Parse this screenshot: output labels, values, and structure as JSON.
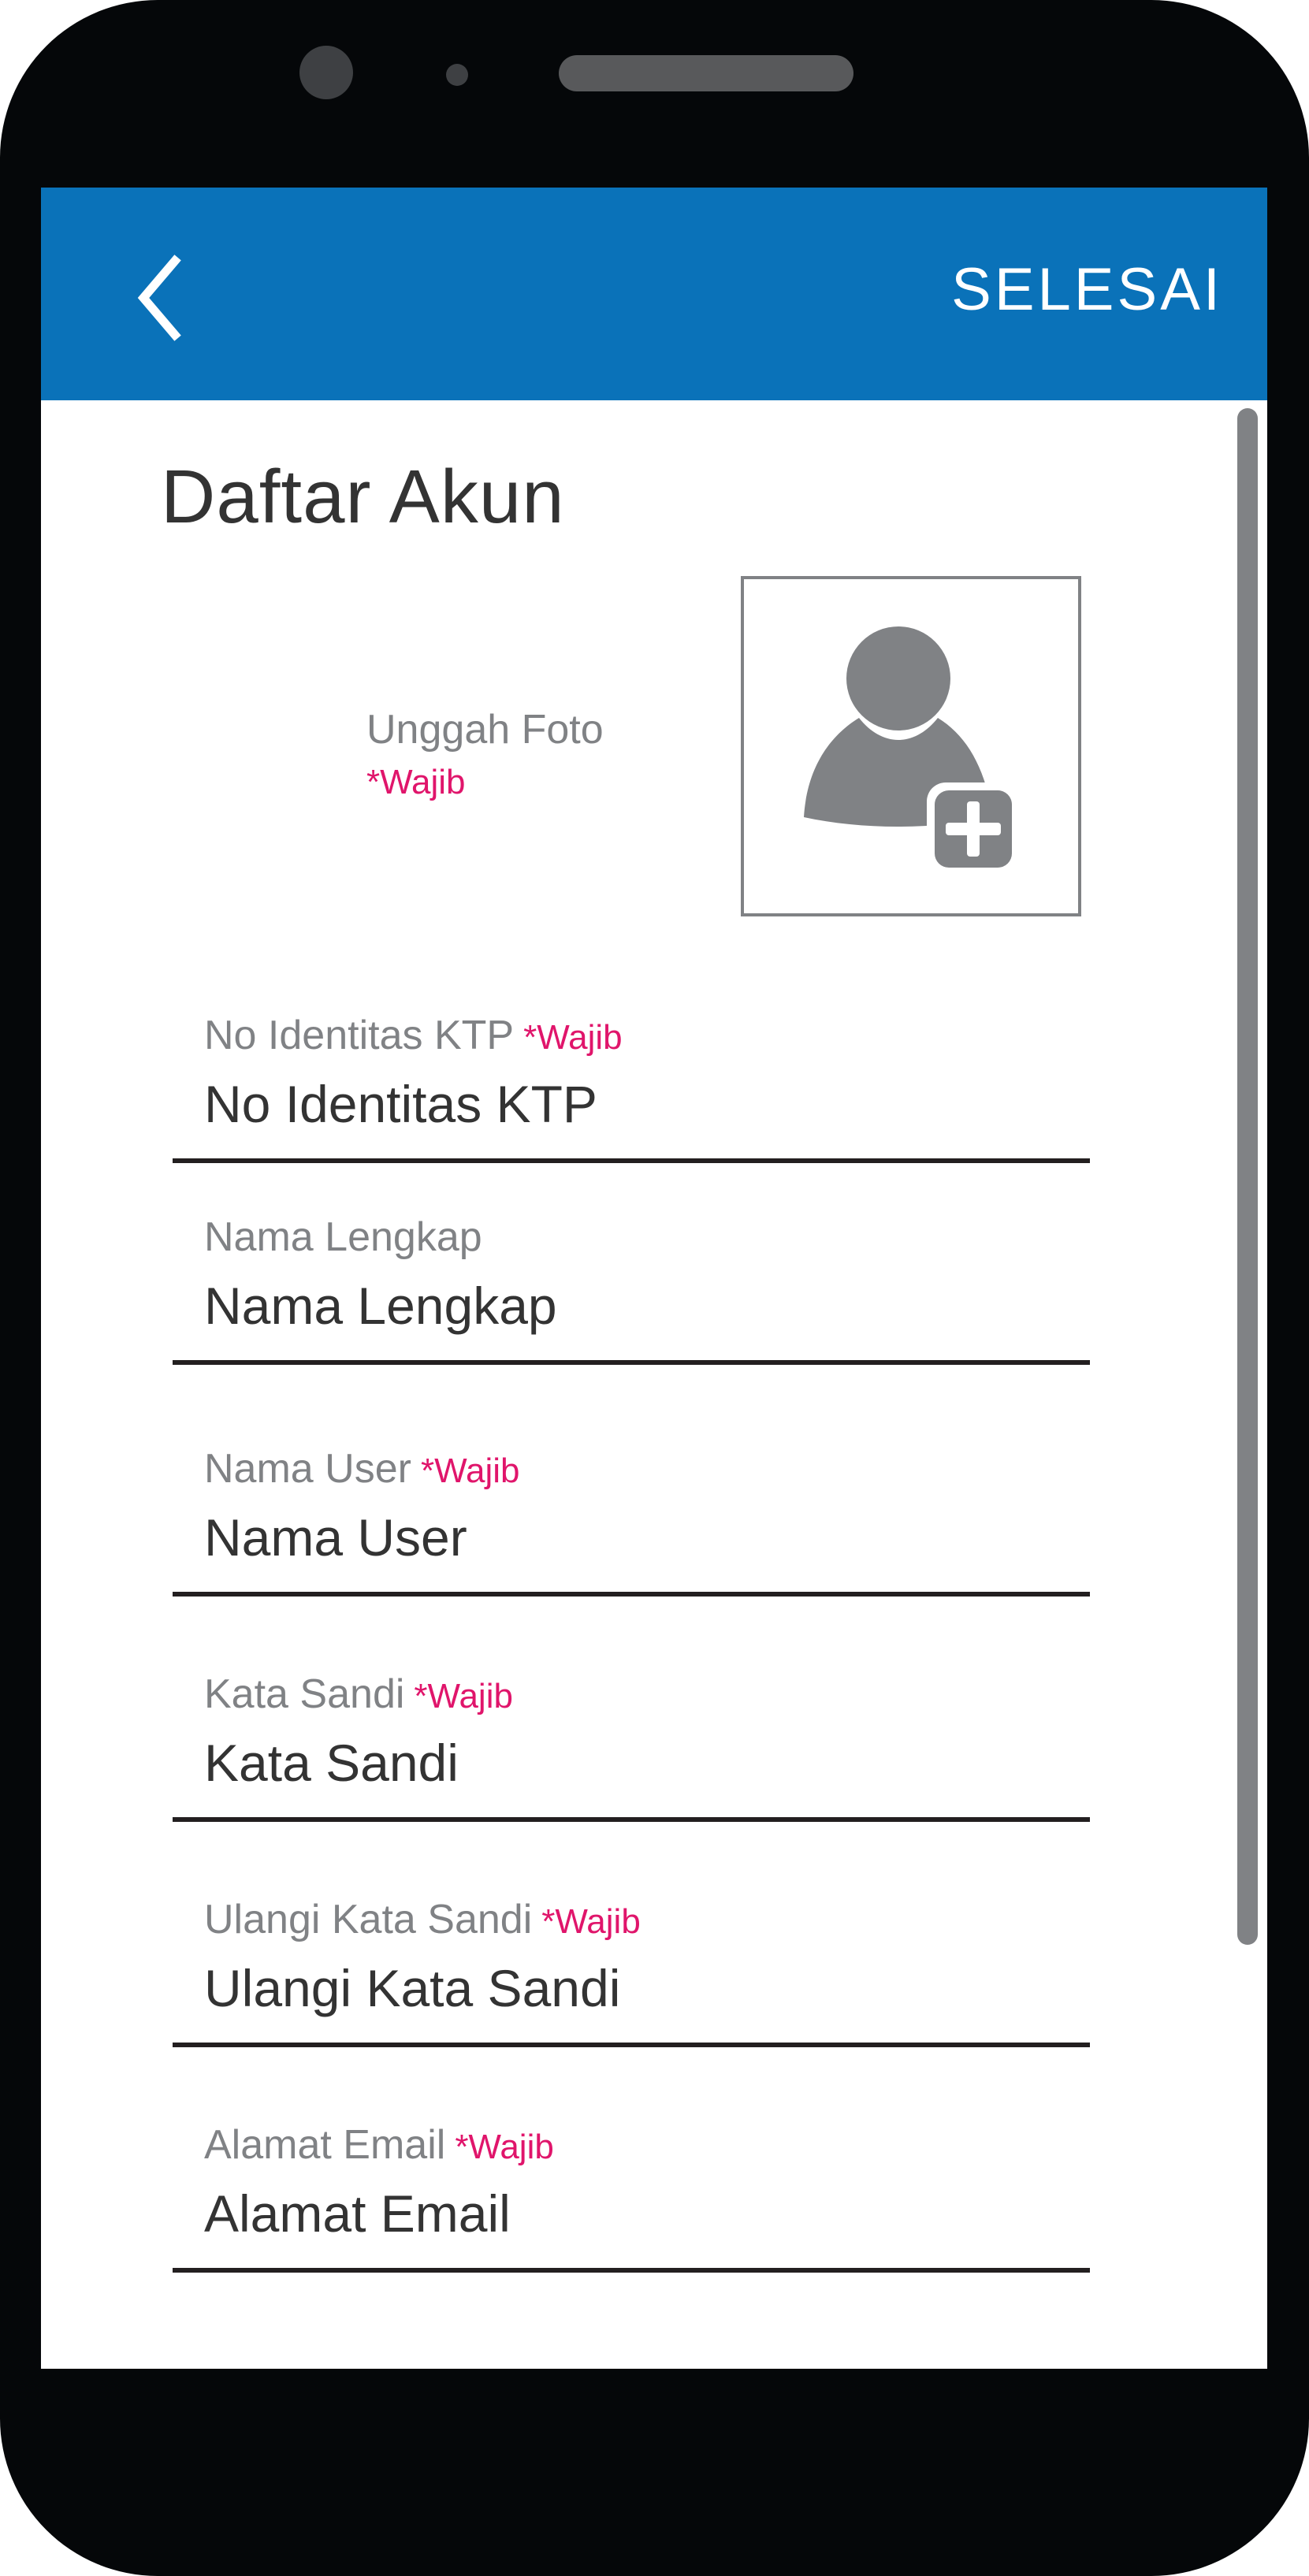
{
  "appbar": {
    "back_icon": "chevron-left-icon",
    "done_label": "SELESAI",
    "color": "#0a72b9"
  },
  "page": {
    "title": "Daftar Akun"
  },
  "photo": {
    "label": "Unggah Foto",
    "required": "*Wajib",
    "icon": "add-user-icon"
  },
  "fields": [
    {
      "label": "No Identitas KTP",
      "required": "*Wajib",
      "placeholder": "No Identitas KTP"
    },
    {
      "label": "Nama Lengkap",
      "required": "",
      "placeholder": "Nama Lengkap"
    },
    {
      "label": "Nama User",
      "required": "*Wajib",
      "placeholder": "Nama User"
    },
    {
      "label": "Kata Sandi",
      "required": "*Wajib",
      "placeholder": "Kata Sandi"
    },
    {
      "label": "Ulangi Kata Sandi",
      "required": "*Wajib",
      "placeholder": "Ulangi Kata Sandi"
    },
    {
      "label": "Alamat Email",
      "required": "*Wajib",
      "placeholder": "Alamat Email"
    }
  ],
  "colors": {
    "required": "#e0156b",
    "label": "#808285",
    "text": "#333333"
  }
}
